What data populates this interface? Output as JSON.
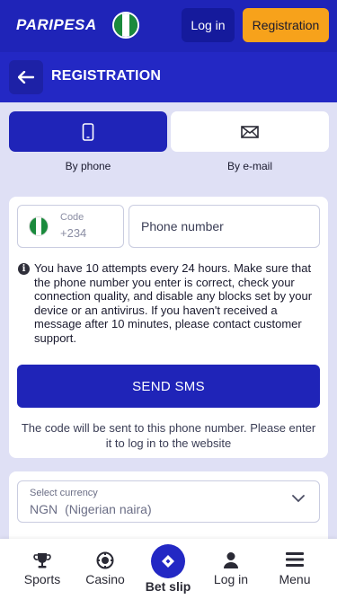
{
  "header": {
    "logo_text": "PARIPESA",
    "login_label": "Log in",
    "registration_label": "Registration"
  },
  "titlebar": {
    "title": "REGISTRATION"
  },
  "methods": {
    "phone_label": "By phone",
    "email_label": "By e-mail",
    "selected": "phone"
  },
  "phone_form": {
    "code_label": "Code",
    "code_value": "+234",
    "phone_placeholder": "Phone number",
    "info_text": "You have 10 attempts every 24 hours. Make sure that the phone number you enter is correct, check your connection quality, and disable any blocks set by your device or an antivirus. If you haven't received a message after 10 minutes, please contact customer support.",
    "send_button": "SEND SMS",
    "hint": "The code will be sent to this phone number. Please enter it to log in to the website"
  },
  "currency": {
    "label": "Select currency",
    "code": "NGN",
    "name": "(Nigerian naira)"
  },
  "bottom_nav": {
    "sports": "Sports",
    "casino": "Casino",
    "bet_slip": "Bet slip",
    "login": "Log in",
    "menu": "Menu"
  },
  "colors": {
    "primary": "#1f24b8",
    "accent": "#f7a21b",
    "background": "#dfe0f5",
    "flag_green": "#1a8a3c"
  },
  "icons": {
    "back": "arrow-left-icon",
    "phone": "smartphone-icon",
    "email": "envelope-icon",
    "info": "info-icon",
    "chevron": "chevron-down-icon",
    "sports": "trophy-icon",
    "casino": "casino-chip-icon",
    "bet_slip": "ticket-icon",
    "login": "user-icon",
    "menu": "hamburger-menu-icon"
  }
}
